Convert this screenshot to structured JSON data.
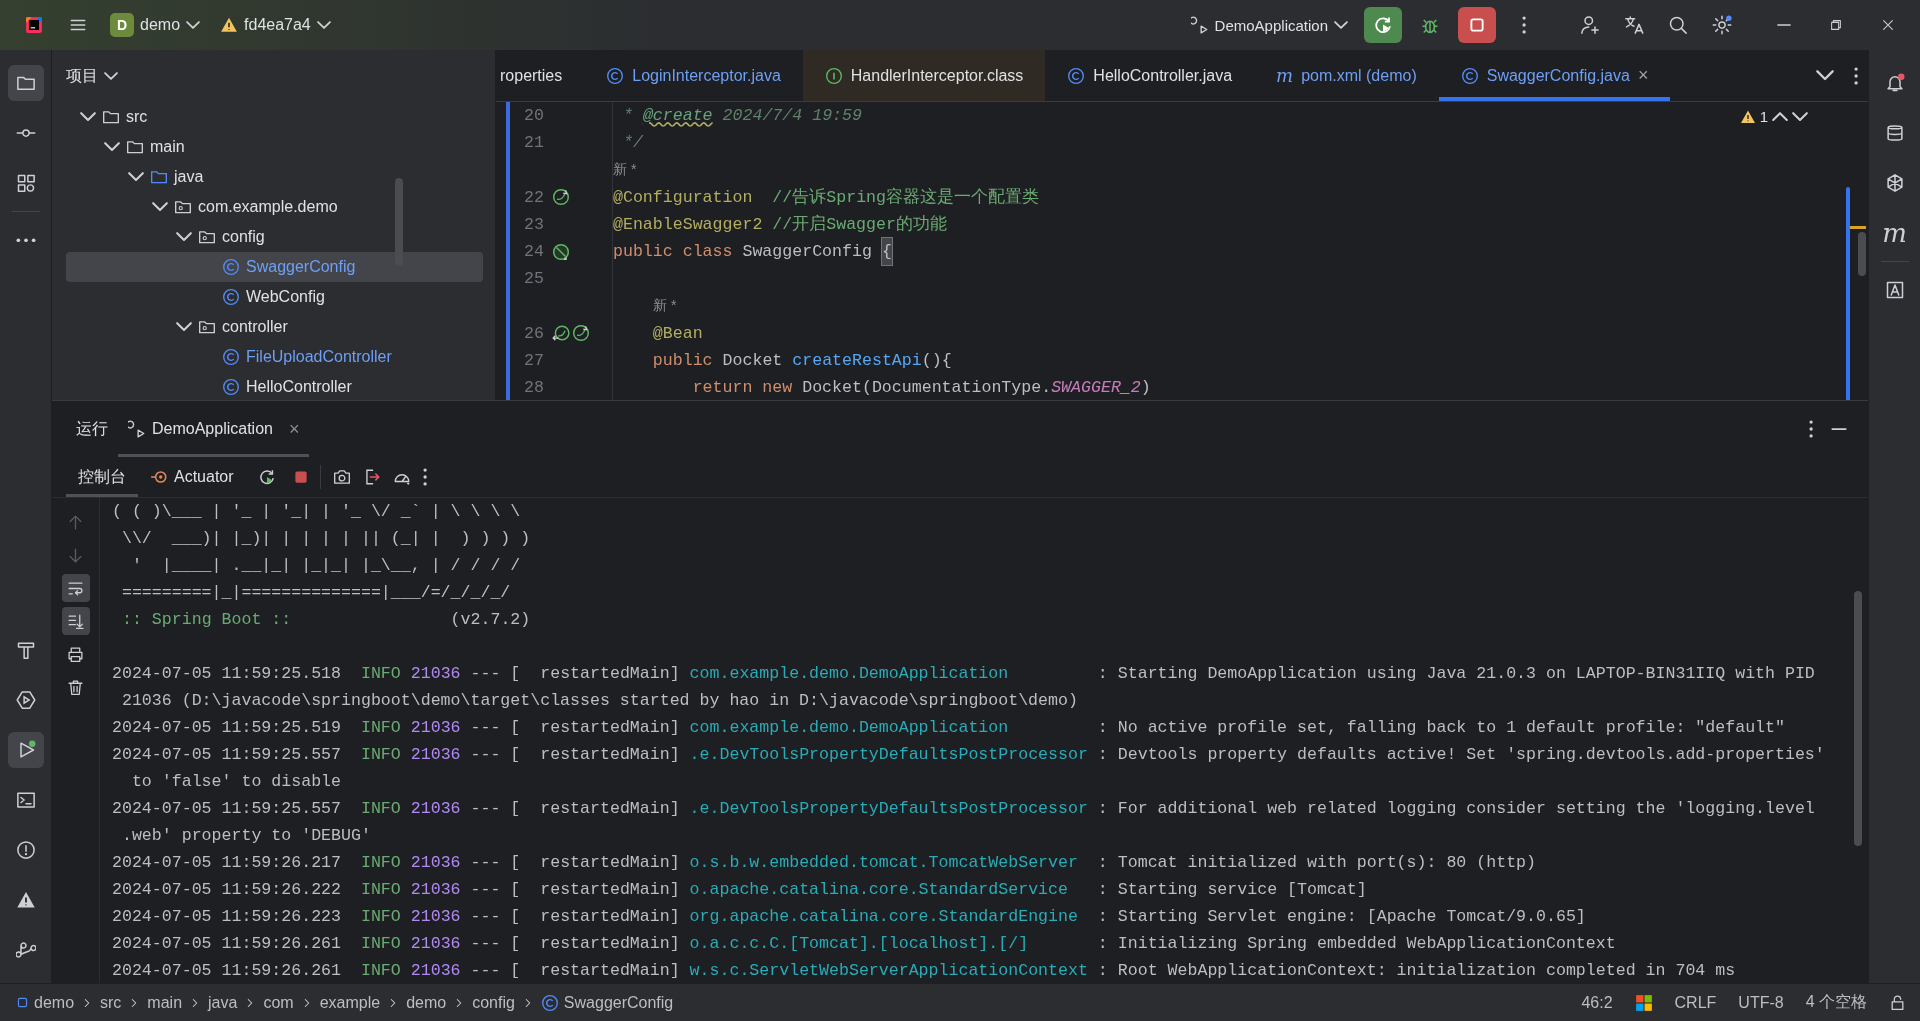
{
  "title_bar": {
    "project": {
      "badge": "D",
      "name": "demo"
    },
    "branch": "fd4ea7a4",
    "run_config": "DemoApplication"
  },
  "left_toolbar": {
    "top": [
      {
        "kind": "project",
        "selected": true
      },
      {
        "kind": "commit",
        "selected": false
      },
      {
        "kind": "structure",
        "selected": false
      },
      {
        "kind": "more",
        "selected": false
      }
    ],
    "bottom": [
      {
        "kind": "build",
        "selected": false
      },
      {
        "kind": "services",
        "selected": false
      },
      {
        "kind": "run",
        "selected": true
      },
      {
        "kind": "terminal",
        "selected": false
      },
      {
        "kind": "problems",
        "selected": false
      },
      {
        "kind": "warnings",
        "selected": false
      },
      {
        "kind": "git",
        "selected": false
      }
    ]
  },
  "right_toolbar": [
    {
      "kind": "notifications"
    },
    {
      "kind": "database"
    },
    {
      "kind": "ai"
    },
    {
      "kind": "maven",
      "glyph": "m"
    },
    {
      "kind": "assistant"
    }
  ],
  "project_panel": {
    "title": "项目",
    "tree": [
      {
        "label": "src",
        "kind": "folder",
        "expanded": true,
        "selected": false,
        "children": [
          {
            "label": "main",
            "kind": "folder",
            "expanded": true,
            "selected": false,
            "children": [
              {
                "label": "java",
                "kind": "source",
                "expanded": true,
                "selected": false,
                "children": [
                  {
                    "label": "com.example.demo",
                    "kind": "package",
                    "expanded": true,
                    "selected": false,
                    "children": [
                      {
                        "label": "config",
                        "kind": "package",
                        "expanded": true,
                        "selected": false,
                        "children": [
                          {
                            "label": "SwaggerConfig",
                            "kind": "class",
                            "selected": true,
                            "modified": true
                          },
                          {
                            "label": "WebConfig",
                            "kind": "class",
                            "selected": false,
                            "modified": false
                          }
                        ]
                      },
                      {
                        "label": "controller",
                        "kind": "package",
                        "expanded": true,
                        "selected": false,
                        "children": [
                          {
                            "label": "FileUploadController",
                            "kind": "class",
                            "selected": false,
                            "modified": true
                          },
                          {
                            "label": "HelloController",
                            "kind": "class",
                            "selected": false,
                            "modified": false
                          }
                        ]
                      }
                    ]
                  }
                ]
              }
            ]
          }
        ]
      }
    ]
  },
  "editor": {
    "tabs": [
      {
        "label": "roperties",
        "kind": "none",
        "selected": false,
        "modified": false,
        "library": false
      },
      {
        "label": "LoginInterceptor.java",
        "kind": "class",
        "selected": false,
        "modified": true,
        "library": false
      },
      {
        "label": "HandlerInterceptor.class",
        "kind": "interface",
        "selected": false,
        "modified": false,
        "library": true
      },
      {
        "label": "HelloController.java",
        "kind": "class",
        "selected": false,
        "modified": false,
        "library": false
      },
      {
        "label": "pom.xml (demo)",
        "kind": "maven",
        "glyph": "m",
        "selected": false,
        "modified": true,
        "library": false
      },
      {
        "label": "SwaggerConfig.java",
        "kind": "class",
        "selected": true,
        "modified": true,
        "library": false,
        "close": "×"
      }
    ],
    "problems": "1",
    "lines": [
      {
        "kind": "code",
        "number": "20",
        "tokens": [
          {
            "text": " * ",
            "kind": "doc"
          },
          {
            "text": "@create",
            "kind": "doc-tag"
          },
          {
            "text": " 2024/7/4 19:59",
            "kind": "doc"
          }
        ]
      },
      {
        "kind": "code",
        "number": "21",
        "tokens": [
          {
            "text": " */",
            "kind": "doc"
          }
        ]
      },
      {
        "kind": "inlay",
        "text": "新 *",
        "nested": false
      },
      {
        "kind": "code",
        "number": "22",
        "markers": [
          {
            "kind": "bean"
          }
        ],
        "tokens": [
          {
            "text": "@Configuration",
            "kind": "annotation"
          },
          {
            "text": "  //告诉Spring容器这是一个配置类",
            "kind": "comment"
          }
        ]
      },
      {
        "kind": "code",
        "number": "23",
        "tokens": [
          {
            "text": "@EnableSwagger2",
            "kind": "annotation"
          },
          {
            "text": " //开启Swagger的功能",
            "kind": "comment"
          }
        ]
      },
      {
        "kind": "code",
        "number": "24",
        "markers": [
          {
            "kind": "bean-class"
          }
        ],
        "tokens": [
          {
            "text": "public class",
            "kind": "keyword"
          },
          {
            "text": " SwaggerConfig ",
            "kind": "plain"
          },
          {
            "text": "{",
            "kind": "brace-match"
          }
        ]
      },
      {
        "kind": "code",
        "number": "25"
      },
      {
        "kind": "inlay",
        "text": "新 *",
        "nested": true
      },
      {
        "kind": "code",
        "number": "26",
        "markers": [
          {
            "kind": "implementation"
          },
          {
            "kind": "bean"
          }
        ],
        "tokens": [
          {
            "text": "    @Bean",
            "kind": "annotation"
          }
        ]
      },
      {
        "kind": "code",
        "number": "27",
        "tokens": [
          {
            "text": "    public",
            "kind": "keyword"
          },
          {
            "text": " Docket ",
            "kind": "plain"
          },
          {
            "text": "createRestApi",
            "kind": "method"
          },
          {
            "text": "(){",
            "kind": "plain"
          }
        ]
      },
      {
        "kind": "code",
        "number": "28",
        "tokens": [
          {
            "text": "        return new",
            "kind": "keyword"
          },
          {
            "text": " Docket(DocumentationType.",
            "kind": "plain"
          },
          {
            "text": "SWAGGER_2",
            "kind": "constant"
          },
          {
            "text": ")",
            "kind": "plain"
          }
        ]
      }
    ]
  },
  "run_panel": {
    "title": "运行",
    "tabs": [
      {
        "label": "DemoApplication",
        "selected": true,
        "close": "×"
      }
    ],
    "console_tabs": [
      {
        "label": "控制台",
        "kind": "console",
        "selected": true
      },
      {
        "label": "Actuator",
        "kind": "actuator",
        "selected": false
      }
    ],
    "gutter": [
      {
        "kind": "up",
        "on": false,
        "disabled": true
      },
      {
        "kind": "down",
        "on": false,
        "disabled": true
      },
      {
        "kind": "soft-wrap",
        "on": true,
        "disabled": false
      },
      {
        "kind": "scroll-end",
        "on": true,
        "disabled": false
      },
      {
        "kind": "print",
        "on": false,
        "disabled": false
      },
      {
        "kind": "clear",
        "on": false,
        "disabled": false
      }
    ],
    "lines": [
      {
        "kind": "banner",
        "text": "( ( )\\___ | '_ | '_| | '_ \\/ _` | \\ \\ \\ \\"
      },
      {
        "kind": "banner",
        "text": " \\\\/  ___)| |_)| | | | | || (_| |  ) ) ) )"
      },
      {
        "kind": "banner",
        "text": "  '  |____| .__|_| |_|_| |_\\__, | / / / /"
      },
      {
        "kind": "banner",
        "text": " =========|_|==============|___/=/_/_/_/"
      },
      {
        "kind": "boot",
        "label": ":: Spring Boot ::",
        "version": "(v2.7.2)"
      },
      {
        "kind": "blank"
      },
      {
        "kind": "log",
        "time": "2024-07-05 11:59:25.518",
        "level": "INFO",
        "pid": "21036",
        "marker": "---",
        "thread": "[  restartedMain]",
        "logger": "com.example.demo.DemoApplication",
        "message": ": Starting DemoApplication using Java 21.0.3 on LAPTOP-BIN31IIQ with PID"
      },
      {
        "kind": "wrap",
        "text": " 21036 (D:\\javacode\\springboot\\demo\\target\\classes started by hao in D:\\javacode\\springboot\\demo)"
      },
      {
        "kind": "log",
        "time": "2024-07-05 11:59:25.519",
        "level": "INFO",
        "pid": "21036",
        "marker": "---",
        "thread": "[  restartedMain]",
        "logger": "com.example.demo.DemoApplication",
        "message": ": No active profile set, falling back to 1 default profile: \"default\""
      },
      {
        "kind": "log",
        "time": "2024-07-05 11:59:25.557",
        "level": "INFO",
        "pid": "21036",
        "marker": "---",
        "thread": "[  restartedMain]",
        "logger": ".e.DevToolsPropertyDefaultsPostProcessor",
        "message": ": Devtools property defaults active! Set 'spring.devtools.add-properties'"
      },
      {
        "kind": "wrap",
        "text": "  to 'false' to disable"
      },
      {
        "kind": "log",
        "time": "2024-07-05 11:59:25.557",
        "level": "INFO",
        "pid": "21036",
        "marker": "---",
        "thread": "[  restartedMain]",
        "logger": ".e.DevToolsPropertyDefaultsPostProcessor",
        "message": ": For additional web related logging consider setting the 'logging.level"
      },
      {
        "kind": "wrap",
        "text": " .web' property to 'DEBUG'"
      },
      {
        "kind": "log",
        "time": "2024-07-05 11:59:26.217",
        "level": "INFO",
        "pid": "21036",
        "marker": "---",
        "thread": "[  restartedMain]",
        "logger": "o.s.b.w.embedded.tomcat.TomcatWebServer",
        "message": ": Tomcat initialized with port(s): 80 (http)"
      },
      {
        "kind": "log",
        "time": "2024-07-05 11:59:26.222",
        "level": "INFO",
        "pid": "21036",
        "marker": "---",
        "thread": "[  restartedMain]",
        "logger": "o.apache.catalina.core.StandardService",
        "message": ": Starting service [Tomcat]"
      },
      {
        "kind": "log",
        "time": "2024-07-05 11:59:26.223",
        "level": "INFO",
        "pid": "21036",
        "marker": "---",
        "thread": "[  restartedMain]",
        "logger": "org.apache.catalina.core.StandardEngine",
        "message": ": Starting Servlet engine: [Apache Tomcat/9.0.65]"
      },
      {
        "kind": "log",
        "time": "2024-07-05 11:59:26.261",
        "level": "INFO",
        "pid": "21036",
        "marker": "---",
        "thread": "[  restartedMain]",
        "logger": "o.a.c.c.C.[Tomcat].[localhost].[/]",
        "message": ": Initializing Spring embedded WebApplicationContext"
      },
      {
        "kind": "log",
        "time": "2024-07-05 11:59:26.261",
        "level": "INFO",
        "pid": "21036",
        "marker": "---",
        "thread": "[  restartedMain]",
        "logger": "w.s.c.ServletWebServerApplicationContext",
        "message": ": Root WebApplicationContext: initialization completed in 704 ms"
      }
    ]
  },
  "status_bar": {
    "breadcrumbs": [
      {
        "label": "demo",
        "kind": "module"
      },
      {
        "label": "src",
        "kind": "folder"
      },
      {
        "label": "main",
        "kind": "folder"
      },
      {
        "label": "java",
        "kind": "folder"
      },
      {
        "label": "com",
        "kind": "folder"
      },
      {
        "label": "example",
        "kind": "folder"
      },
      {
        "label": "demo",
        "kind": "folder"
      },
      {
        "label": "config",
        "kind": "folder"
      },
      {
        "label": "SwaggerConfig",
        "kind": "class"
      }
    ],
    "position": "46:2",
    "line_separator": "CRLF",
    "encoding": "UTF-8",
    "indent": "4 个空格"
  }
}
